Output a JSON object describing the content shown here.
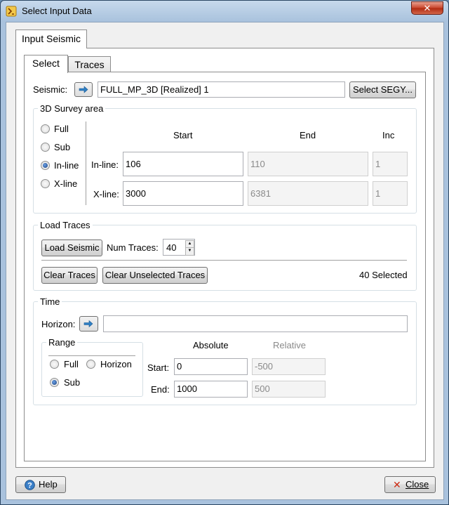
{
  "window": {
    "title": "Select Input Data",
    "close_glyph": "✕"
  },
  "outer_tab": {
    "label": "Input Seismic"
  },
  "inner_tabs": [
    {
      "label": "Select"
    },
    {
      "label": "Traces"
    }
  ],
  "seismic": {
    "label": "Seismic:",
    "value": "FULL_MP_3D [Realized] 1",
    "select_button": "Select SEGY..."
  },
  "survey": {
    "title": "3D Survey area",
    "options": [
      "Full",
      "Sub",
      "In-line",
      "X-line"
    ],
    "selected": "In-line",
    "headers": {
      "start": "Start",
      "end": "End",
      "inc": "Inc"
    },
    "inline": {
      "label": "In-line:",
      "start": "106",
      "end": "110",
      "inc": "1"
    },
    "xline": {
      "label": "X-line:",
      "start": "3000",
      "end": "6381",
      "inc": "1"
    }
  },
  "load_traces": {
    "title": "Load Traces",
    "load_button": "Load Seismic",
    "num_traces_label": "Num Traces:",
    "num_traces": "40",
    "clear_button": "Clear Traces",
    "clear_unselected_button": "Clear Unselected Traces",
    "selected_count": "40 Selected"
  },
  "time": {
    "title": "Time",
    "horizon_label": "Horizon:",
    "horizon_value": "",
    "range": {
      "title": "Range",
      "options": [
        "Full",
        "Horizon",
        "Sub"
      ],
      "selected": "Sub"
    },
    "headers": {
      "absolute": "Absolute",
      "relative": "Relative"
    },
    "start": {
      "label": "Start:",
      "absolute": "0",
      "relative": "-500"
    },
    "end": {
      "label": "End:",
      "absolute": "1000",
      "relative": "500"
    }
  },
  "footer": {
    "help_button": "Help",
    "close_button": "Close"
  },
  "colors": {
    "accent": "#2f7fc4",
    "close_x": "#cc2a12",
    "help_icon": "#3a7fc8"
  }
}
